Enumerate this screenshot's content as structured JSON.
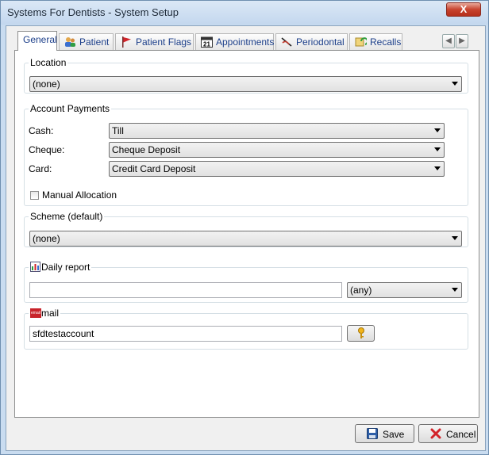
{
  "window": {
    "title": "Systems For Dentists - System Setup",
    "close_glyph": "X"
  },
  "tabs": [
    {
      "label": "General",
      "icon": "none",
      "active": true
    },
    {
      "label": "Patient",
      "icon": "people-icon"
    },
    {
      "label": "Patient Flags",
      "icon": "flag-icon"
    },
    {
      "label": "Appointments",
      "icon": "calendar-icon",
      "calendar_day": "21"
    },
    {
      "label": "Periodontal",
      "icon": "perio-icon"
    },
    {
      "label": "Recalls",
      "icon": "recall-icon"
    }
  ],
  "location": {
    "label": "Location",
    "value": "(none)"
  },
  "account_payments": {
    "label": "Account Payments",
    "rows": [
      {
        "label": "Cash:",
        "value": "Till"
      },
      {
        "label": "Cheque:",
        "value": "Cheque Deposit"
      },
      {
        "label": "Card:",
        "value": "Credit Card Deposit"
      }
    ],
    "manual_allocation_label": "Manual Allocation",
    "manual_allocation_checked": false
  },
  "scheme": {
    "label": "Scheme (default)",
    "value": "(none)"
  },
  "daily_report": {
    "label": "Daily report",
    "input_value": "",
    "select_value": "(any)"
  },
  "email": {
    "icon_text": "email",
    "label": "mail",
    "value": "sfdtestaccount"
  },
  "buttons": {
    "save": "Save",
    "cancel": "Cancel"
  },
  "colors": {
    "tab_text": "#1c3f8a",
    "close_button": "#c8432e",
    "frame": "#c9dcf0"
  }
}
